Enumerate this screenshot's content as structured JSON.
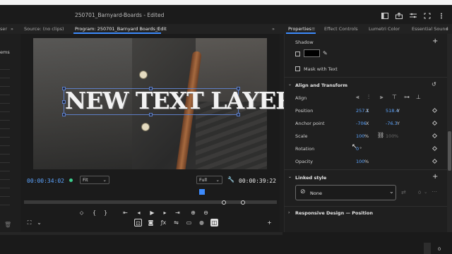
{
  "app": {
    "title": "250701_Barnyard-Boards - Edited"
  },
  "tabs_left": {
    "truncated": "ser",
    "source": "Source: (no clips)",
    "program": "Program: 250701_Barnyard Boards_Edit"
  },
  "left_panel": {
    "truncated_label": "ems"
  },
  "monitor": {
    "overlay_text": "NEW TEXT LAYER",
    "timecode_current": "00:00:34:02",
    "zoom": "Fit",
    "quality": "Full",
    "timecode_total": "00:00:39:22"
  },
  "properties_tabs": {
    "properties": "Properties",
    "effect_controls": "Effect Controls",
    "lumetri": "Lumetri Color",
    "essential_sound": "Essential Sound"
  },
  "properties": {
    "shadow_label": "Shadow",
    "mask_with_text": "Mask with Text",
    "align_transform": "Align and Transform",
    "align_label": "Align",
    "position_label": "Position",
    "position_x": "257.1",
    "position_y": "518.4",
    "x_unit": "X",
    "y_unit": "Y",
    "anchor_label": "Anchor point",
    "anchor_x": "-706",
    "anchor_y": "-76.3",
    "scale_label": "Scale",
    "scale_value": "100",
    "scale_second": "100",
    "percent": "%",
    "rotation_label": "Rotation",
    "rotation_value": "0",
    "degree": "°",
    "opacity_label": "Opacity",
    "opacity_value": "100",
    "linked_style": "Linked style",
    "style_none": "None",
    "style_count": "0",
    "responsive_design": "Responsive Design — Position"
  },
  "colors": {
    "accent": "#3d8bfd",
    "value_blue": "#5da5ff",
    "panel": "#1f1f1f"
  }
}
